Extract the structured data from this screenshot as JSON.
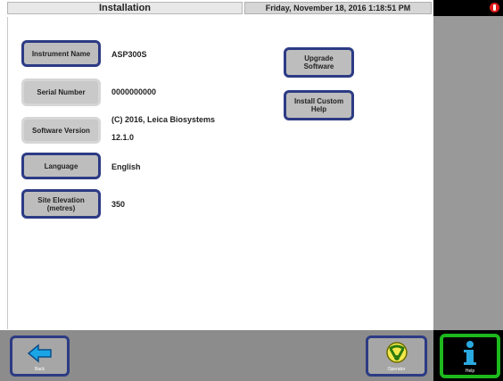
{
  "titlebar": {
    "title": "Installation",
    "datetime": "Friday, November 18, 2016 1:18:51 PM",
    "alarm_icon": "alert-icon"
  },
  "settings": {
    "instrument_name": {
      "label": "Instrument Name",
      "value": "ASP300S"
    },
    "serial_number": {
      "label": "Serial Number",
      "value": "0000000000"
    },
    "software_version": {
      "label": "Software Version",
      "value_line1": "(C) 2016, Leica Biosystems",
      "value_line2": "12.1.0"
    },
    "language": {
      "label": "Language",
      "value": "English"
    },
    "site_elevation": {
      "label_line1": "Site Elevation",
      "label_line2": "(metres)",
      "value": "350"
    }
  },
  "actions": {
    "upgrade_line1": "Upgrade",
    "upgrade_line2": "Software",
    "install_line1": "Install Custom",
    "install_line2": "Help"
  },
  "bottombar": {
    "back_label": "Back",
    "operator_label": "Operator",
    "help_label": "Help"
  },
  "colors": {
    "button_border": "#2c3b84",
    "help_border": "#1db81d",
    "alarm": "#e01b1b"
  }
}
